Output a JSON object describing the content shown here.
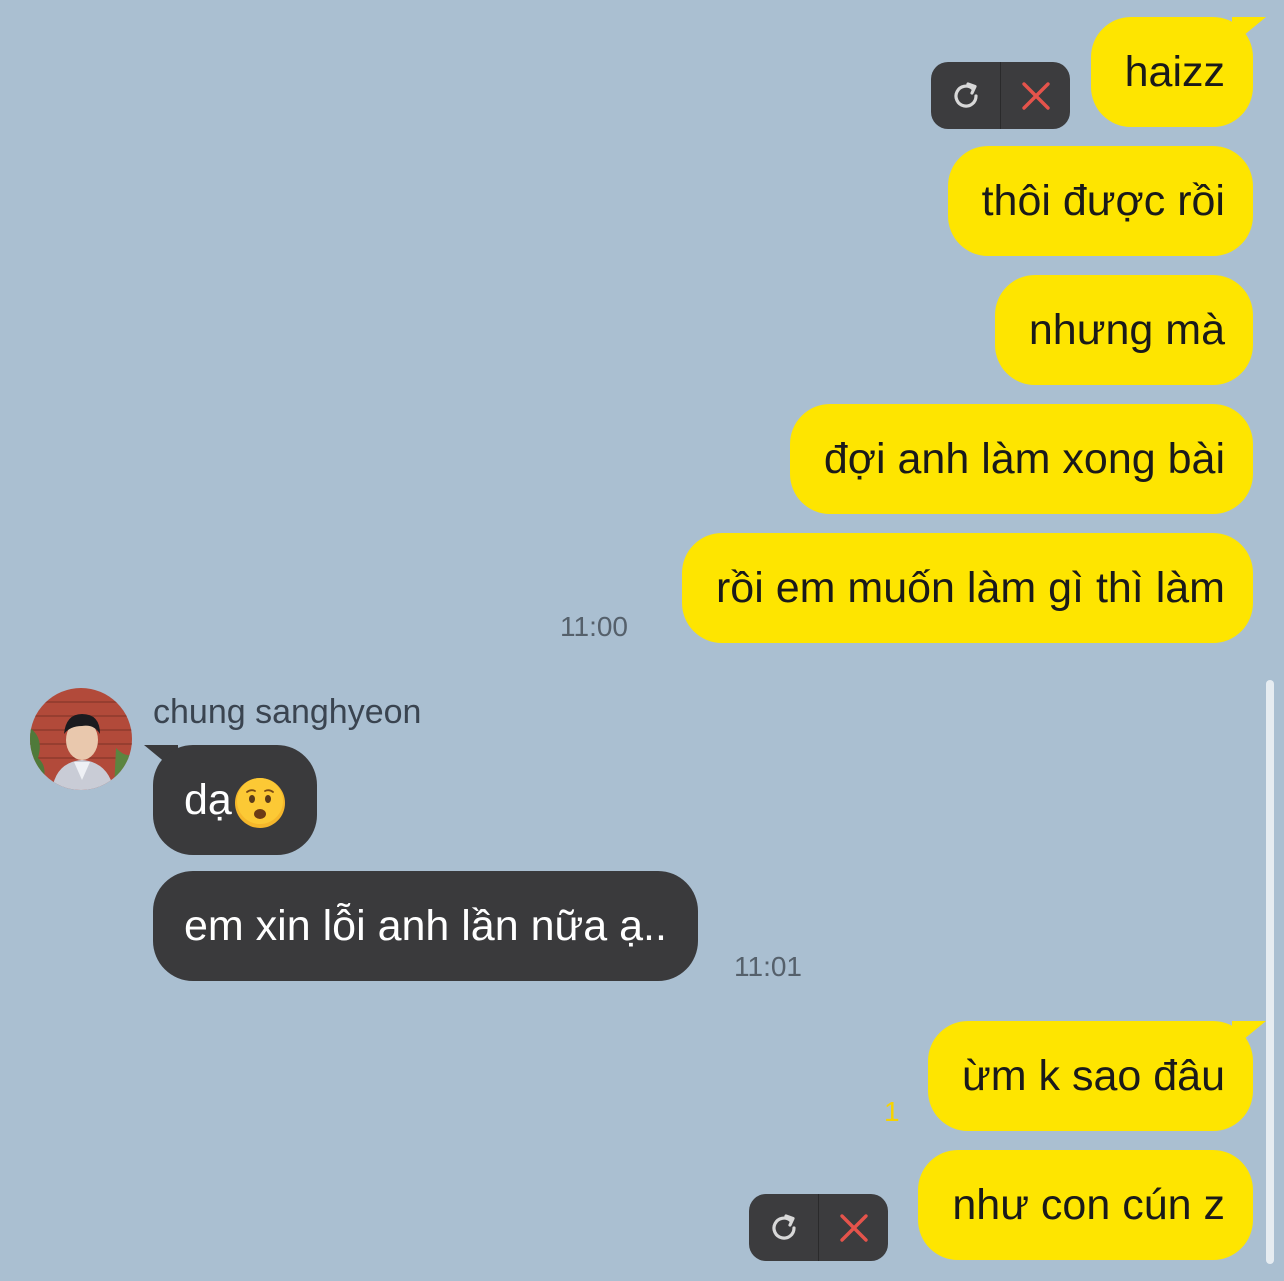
{
  "messages": [
    {
      "text": "haizz"
    },
    {
      "text": "thôi được rồi"
    },
    {
      "text": "nhưng mà"
    },
    {
      "text": "đợi anh làm xong bài"
    },
    {
      "text": "rồi em muốn làm gì thì làm"
    },
    {
      "text": "dạ"
    },
    {
      "text": "em xin lỗi anh lần nữa ạ.."
    },
    {
      "text": "ừm k sao đâu"
    },
    {
      "text": "như con cún z"
    }
  ],
  "timestamps": {
    "first": "11:00",
    "second": "11:01"
  },
  "contact": {
    "name": "chung sanghyeon",
    "avatar_icon": "profile-photo"
  },
  "unread_count": "1",
  "failed_actions": {
    "retry_icon": "retry-icon",
    "delete_icon": "close-icon"
  },
  "colors": {
    "background": "#aabfd1",
    "my_bubble": "#fee500",
    "their_bubble": "#3a3a3c",
    "delete_x": "#e5534b",
    "unread": "#f7d300"
  }
}
